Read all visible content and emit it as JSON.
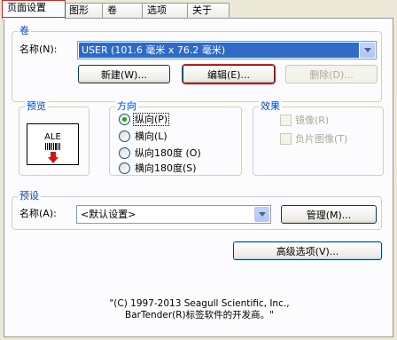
{
  "tabs": [
    {
      "label": "页面设置",
      "active": true
    },
    {
      "label": "图形",
      "active": false
    },
    {
      "label": "卷",
      "active": false
    },
    {
      "label": "选项",
      "active": false
    },
    {
      "label": "关于",
      "active": false
    }
  ],
  "roll": {
    "group_label": "卷",
    "name_label": "名称(N):",
    "name_value": "USER (101.6 毫米 x 76.2 毫米)",
    "new_button": "新建(W)...",
    "edit_button": "编辑(E)...",
    "delete_button": "删除(D)..."
  },
  "preview": {
    "group_label": "预览",
    "sample_text": "ALE"
  },
  "orientation": {
    "group_label": "方向",
    "options": [
      {
        "label": "纵向(P)",
        "selected": true
      },
      {
        "label": "横向(L)",
        "selected": false
      },
      {
        "label": "纵向180度 (O)",
        "selected": false
      },
      {
        "label": "横向180度(S)",
        "selected": false
      }
    ]
  },
  "effects": {
    "group_label": "效果",
    "options": [
      {
        "label": "镜像(R)",
        "checked": false,
        "enabled": false
      },
      {
        "label": "负片图像(T)",
        "checked": false,
        "enabled": false
      }
    ]
  },
  "presets": {
    "group_label": "预设",
    "name_label": "名称(A):",
    "name_value": "<默认设置>",
    "manage_button": "管理(M)..."
  },
  "advanced_button": "高级选项(V)...",
  "copyright": {
    "line1": "\"(C) 1997-2013 Seagull Scientific, Inc.,",
    "line2": "BarTender(R)标签软件的开发商。\""
  },
  "colors": {
    "dialog_bg": "#ece9d8",
    "group_label": "#0046d5",
    "selection": "#316ac5",
    "highlight_red": "#d62525",
    "radio_dot": "#21a121",
    "preview_arrow": "#e01010"
  }
}
